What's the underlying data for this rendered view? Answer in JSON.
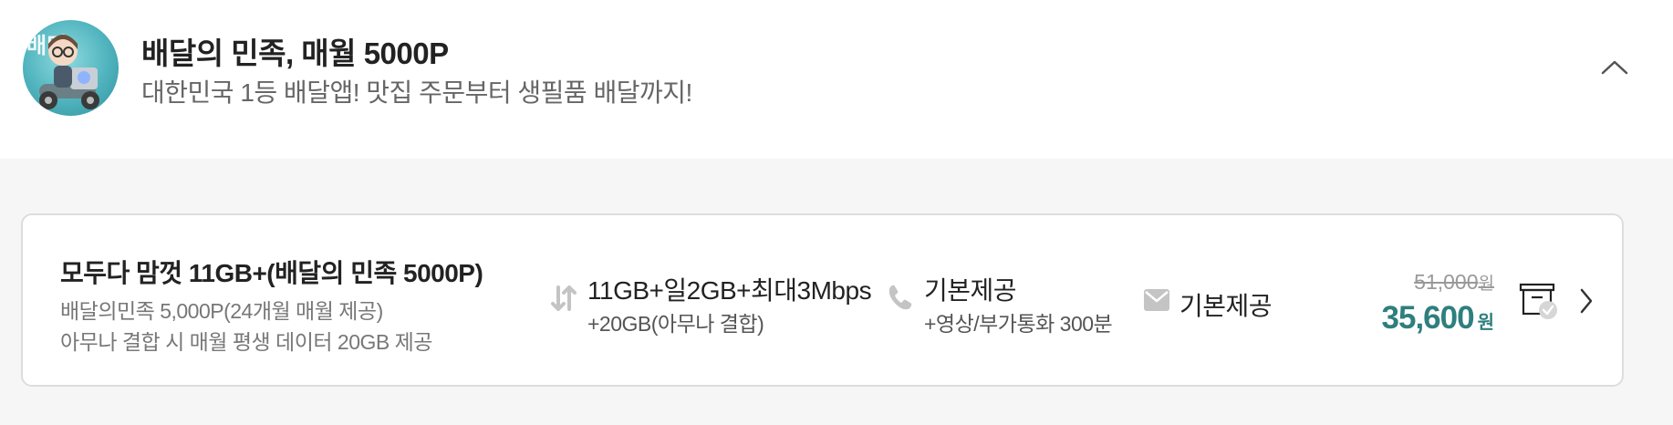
{
  "brand": {
    "title": "배달의 민족, 매월 5000P",
    "subtitle": "대한민국 1등 배달앱! 맛집 주문부터 생필품 배달까지!",
    "avatar_icon": "delivery-rider-avatar",
    "avatar_text": "배민"
  },
  "header": {
    "collapse_icon": "chevron-up-icon"
  },
  "plan": {
    "name": "모두다 맘껏 11GB+(배달의 민족 5000P)",
    "benefit_line1": "배달의민족 5,000P(24개월 매월 제공)",
    "benefit_line2": "아무나 결합 시 매월 평생 데이터 20GB 제공",
    "data": {
      "icon": "data-transfer-icon",
      "main": "11GB+일2GB+최대3Mbps",
      "sub": "+20GB(아무나 결합)"
    },
    "voice": {
      "icon": "phone-icon",
      "main": "기본제공",
      "sub": "+영상/부가통화 300분"
    },
    "sms": {
      "icon": "envelope-icon",
      "main": "기본제공"
    },
    "price": {
      "original": "51,000",
      "original_unit": "원",
      "current": "35,600",
      "current_unit": "원"
    },
    "compare_icon": "compare-box-check-icon",
    "detail_icon": "chevron-right-icon"
  },
  "colors": {
    "accent": "#2e7f7d",
    "background_gray": "#f6f6f6",
    "card_border": "#dddddd",
    "icon_gray": "#c4c4c4"
  }
}
